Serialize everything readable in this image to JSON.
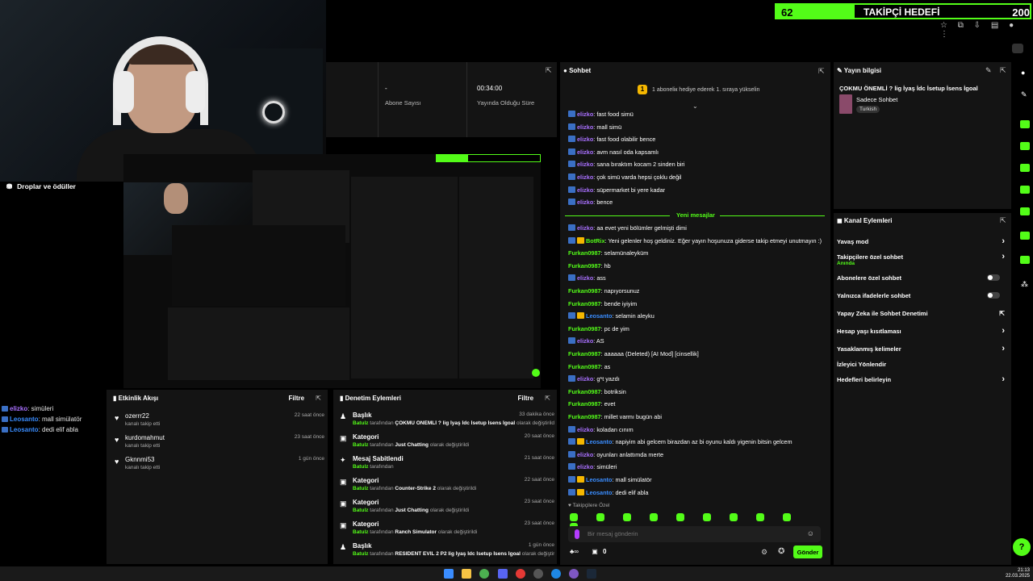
{
  "goal": {
    "current": "62",
    "label": "TAKİPÇİ HEDEFİ",
    "target": "200",
    "progress": 0.31,
    "accent": "#53fc18"
  },
  "stats": [
    {
      "value": "",
      "label": ""
    },
    {
      "value": "-",
      "label": "Abone Sayısı"
    },
    {
      "value": "00:34:00",
      "label": "Yayında Olduğu Süre"
    }
  ],
  "drops_label": "Droplar ve ödüller",
  "overlay_chat": [
    {
      "user": "elizko",
      "text": ": simüleri",
      "color": "#a970ff",
      "badge": true
    },
    {
      "user": "Leosanto",
      "text": ": mall simülatör",
      "color": "#3a8dff",
      "badge": true
    },
    {
      "user": "Leosanto",
      "text": ": dedi elif abla",
      "color": "#3a8dff",
      "badge": true
    }
  ],
  "activity": {
    "title": "Etkinlik Akışı",
    "filter": "Filtre",
    "items": [
      {
        "name": "ozerrr22",
        "sub": "kanalı takip etti",
        "time": "22 saat önce"
      },
      {
        "name": "kurdomahmut",
        "sub": "kanalı takip etti",
        "time": "23 saat önce"
      },
      {
        "name": "Gknnmi53",
        "sub": "kanalı takip etti",
        "time": "1 gün önce"
      }
    ]
  },
  "modlog": {
    "title": "Denetim Eylemleri",
    "filter": "Filtre",
    "items": [
      {
        "title": "Başlık",
        "user": "Batulz",
        "mid": " tarafından ",
        "value": "ÇOKMU ÖNEMLİ ? lig İyaş İdc İsetup İsens İgoal",
        "end": " olarak değiştirildi",
        "time": "33 dakika önce",
        "icon": "title-icon"
      },
      {
        "title": "Kategori",
        "user": "Batulz",
        "mid": " tarafından ",
        "value": "Just Chatting",
        "end": " olarak değiştirildi",
        "time": "20 saat önce",
        "icon": "category-icon"
      },
      {
        "title": "Mesaj Sabitlendi",
        "user": "Batulz",
        "mid": " tarafından",
        "value": "",
        "end": "",
        "time": "21 saat önce",
        "icon": "pin-icon"
      },
      {
        "title": "Kategori",
        "user": "Batulz",
        "mid": " tarafından ",
        "value": "Counter-Strike 2",
        "end": " olarak değiştirildi",
        "time": "22 saat önce",
        "icon": "category-icon"
      },
      {
        "title": "Kategori",
        "user": "Batulz",
        "mid": " tarafından ",
        "value": "Just Chatting",
        "end": " olarak değiştirildi",
        "time": "23 saat önce",
        "icon": "category-icon"
      },
      {
        "title": "Kategori",
        "user": "Batulz",
        "mid": " tarafından ",
        "value": "Ranch Simulator",
        "end": " olarak değiştirildi",
        "time": "23 saat önce",
        "icon": "category-icon"
      },
      {
        "title": "Başlık",
        "user": "Batulz",
        "mid": " tarafından ",
        "value": "RESIDENT EVIL 2 P2 lig İyaş İdc İsetup İsens İgoal",
        "end": " olarak değiştirildi",
        "time": "1 gün önce",
        "icon": "title-icon"
      }
    ]
  },
  "chat": {
    "title": "Sohbet",
    "pinned": "1 aboneliк hediye ederek 1. sıraya yükselin",
    "new_messages": "Yeni mesajlar",
    "messages": [
      {
        "user": "elizko",
        "color": "#a970ff",
        "text": ": fast food simü",
        "badge": "b"
      },
      {
        "user": "elizko",
        "color": "#a970ff",
        "text": ": mall simü",
        "badge": "b"
      },
      {
        "user": "elizko",
        "color": "#a970ff",
        "text": ": fast food olabilir bence",
        "badge": "b"
      },
      {
        "user": "elizko",
        "color": "#a970ff",
        "text": ": avm nasıl oda kapsamlı",
        "badge": "b"
      },
      {
        "user": "elizko",
        "color": "#a970ff",
        "text": ": sana bıraktım kocam 2 sinden biri",
        "badge": "b"
      },
      {
        "user": "elizko",
        "color": "#a970ff",
        "text": ": çok simü varda hepsi çoklu değil",
        "badge": "b"
      },
      {
        "user": "elizko",
        "color": "#a970ff",
        "text": ": süpermarket bi yere kadar",
        "badge": "b"
      },
      {
        "user": "elizko",
        "color": "#a970ff",
        "text": ": bence",
        "badge": "b"
      },
      {
        "user": "elizko",
        "color": "#a970ff",
        "text": ": aa evet yeni bölümler gelmişti dimi",
        "badge": "b"
      },
      {
        "user": "BotRix",
        "color": "#53fc18",
        "text": ": Yeni gelenler hoş geldiniz. Eğer yayın hoşunuza giderse takip etmeyi unutmayın :)",
        "badge": "bg"
      },
      {
        "user": "Furkan0987",
        "color": "#53fc18",
        "text": ": selamünaleyküm",
        "badge": ""
      },
      {
        "user": "Furkan0987",
        "color": "#53fc18",
        "text": ": hb",
        "badge": ""
      },
      {
        "user": "elizko",
        "color": "#a970ff",
        "text": ": ass",
        "badge": "b"
      },
      {
        "user": "Furkan0987",
        "color": "#53fc18",
        "text": ": napıyorsunuz",
        "badge": ""
      },
      {
        "user": "Furkan0987",
        "color": "#53fc18",
        "text": ": bende iyiyim",
        "badge": ""
      },
      {
        "user": "Leosanto",
        "color": "#3a8dff",
        "text": ": selamin aleyku",
        "badge": "bg"
      },
      {
        "user": "Furkan0987",
        "color": "#53fc18",
        "text": ": pc de yim",
        "badge": ""
      },
      {
        "user": "elizko",
        "color": "#a970ff",
        "text": ": AS",
        "badge": "b"
      },
      {
        "user": "Furkan0987",
        "color": "#53fc18",
        "text": ": aaaaaa (Deleted) [AI Mod] [cinsellik]",
        "badge": ""
      },
      {
        "user": "Furkan0987",
        "color": "#53fc18",
        "text": ": as",
        "badge": ""
      },
      {
        "user": "elizko",
        "color": "#a970ff",
        "text": ": g*t yazdı",
        "badge": "b"
      },
      {
        "user": "Furkan0987",
        "color": "#53fc18",
        "text": ": botriksin",
        "badge": ""
      },
      {
        "user": "Furkan0987",
        "color": "#53fc18",
        "text": ": evet",
        "badge": ""
      },
      {
        "user": "Furkan0987",
        "color": "#53fc18",
        "text": ": millet varmı bugün abi",
        "badge": ""
      },
      {
        "user": "elizko",
        "color": "#a970ff",
        "text": ": koladan cınım",
        "badge": "b"
      },
      {
        "user": "Leosanto",
        "color": "#3a8dff",
        "text": ": napiyim abi gelcem birazdan az bi oyunu kaldı yigenin bitsin gelcem",
        "badge": "bg"
      },
      {
        "user": "elizko",
        "color": "#a970ff",
        "text": ": oyunları anlattımda merte",
        "badge": "b"
      },
      {
        "user": "elizko",
        "color": "#a970ff",
        "text": ": simüleri",
        "badge": "b"
      },
      {
        "user": "Leosanto",
        "color": "#3a8dff",
        "text": ": mall simülatör",
        "badge": "bg"
      },
      {
        "user": "Leosanto",
        "color": "#3a8dff",
        "text": ": dedi elif abla",
        "badge": "bg"
      }
    ],
    "followers_only": "Takipçilere Özel",
    "input_placeholder": "Bir mesaj gönderin",
    "send_label": "Gönder",
    "points": "0"
  },
  "stream_info": {
    "title": "Yayın bilgisi",
    "stream_title": "ÇOKMU ÖNEMLİ ? lig İyaş İdc İsetup İsens İgoal",
    "category": "Sadece Sohbet",
    "language": "Turkish"
  },
  "channel": {
    "title": "Kanal Eylemleri",
    "items": [
      {
        "label": "Yavaş mod",
        "control": "chevron"
      },
      {
        "label": "Takipçilere özel sohbet",
        "sub": "Anında",
        "control": "chevron"
      },
      {
        "label": "Abonelere özel sohbet",
        "control": "toggle"
      },
      {
        "label": "Yalnızca ifadelerle sohbet",
        "control": "toggle"
      },
      {
        "label": "Yapay Zeka ile Sohbet Denetimi",
        "control": "external"
      },
      {
        "label": "Hesap yaşı kısıtlaması",
        "control": "chevron"
      },
      {
        "label": "Yasaklanmış kelimeler",
        "control": "chevron"
      },
      {
        "label": "İzleyici Yönlendir",
        "control": ""
      },
      {
        "label": "Hedefleri belirleyin",
        "control": "chevron"
      }
    ]
  },
  "clock": {
    "time": "21:13",
    "date": "22.03.2025"
  }
}
